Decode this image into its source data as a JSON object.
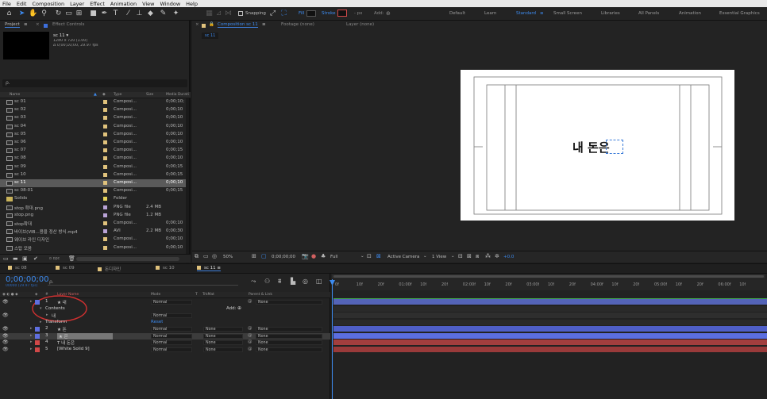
{
  "menu": [
    "File",
    "Edit",
    "Composition",
    "Layer",
    "Effect",
    "Animation",
    "View",
    "Window",
    "Help"
  ],
  "toolbar": {
    "snapping_label": "Snapping",
    "fill_label": "Fill",
    "stroke_label": "Stroke",
    "stroke_px": "- px",
    "add_label": "Add:",
    "workspaces": [
      "Default",
      "Learn",
      "Standard",
      "Small Screen",
      "Libraries",
      "All Panels",
      "Animation",
      "Essential Graphics"
    ],
    "active_workspace": "Standard"
  },
  "project_panel": {
    "tab_project": "Project",
    "tab_effect_controls": "Effect Controls",
    "selected_name": "sc 11 ▾",
    "selected_res": "1280 x 720 (1.00)",
    "selected_dur": "Δ 0;00;10;00, 29.97 fps",
    "search_placeholder": "ρ.",
    "columns": {
      "name": "Name",
      "type": "Type",
      "size": "Size",
      "duration": "Media Durati"
    },
    "items": [
      {
        "name": "sc 01",
        "type": "Composi...",
        "size": "",
        "dur": "0;00;10;",
        "color": "#e0c27c"
      },
      {
        "name": "sc 02",
        "type": "Composi...",
        "size": "",
        "dur": "0;00;10",
        "color": "#e0c27c"
      },
      {
        "name": "sc 03",
        "type": "Composi...",
        "size": "",
        "dur": "0;00;10",
        "color": "#e0c27c"
      },
      {
        "name": "sc 04",
        "type": "Composi...",
        "size": "",
        "dur": "0;00;10",
        "color": "#e0c27c"
      },
      {
        "name": "sc 05",
        "type": "Composi...",
        "size": "",
        "dur": "0;00;10",
        "color": "#e0c27c"
      },
      {
        "name": "sc 06",
        "type": "Composi...",
        "size": "",
        "dur": "0;00;10",
        "color": "#e0c27c"
      },
      {
        "name": "sc 07",
        "type": "Composi...",
        "size": "",
        "dur": "0;00;15",
        "color": "#e0c27c"
      },
      {
        "name": "sc 08",
        "type": "Composi...",
        "size": "",
        "dur": "0;00;10",
        "color": "#e0c27c"
      },
      {
        "name": "sc 09",
        "type": "Composi...",
        "size": "",
        "dur": "0;00;15",
        "color": "#e0c27c"
      },
      {
        "name": "sc 10",
        "type": "Composi...",
        "size": "",
        "dur": "0;00;15",
        "color": "#e0c27c"
      },
      {
        "name": "sc 11",
        "type": "Composi...",
        "size": "",
        "dur": "0;00;10",
        "color": "#e0c27c",
        "selected": true
      },
      {
        "name": "sc 08-01",
        "type": "Composi...",
        "size": "",
        "dur": "0;00;15",
        "color": "#e0c27c"
      },
      {
        "name": "Solids",
        "type": "Folder",
        "size": "",
        "dur": "",
        "color": "#e6d25a"
      },
      {
        "name": "stop 확대.png",
        "type": "PNG file",
        "size": "2.4 MB",
        "dur": "",
        "color": "#b9a3d6"
      },
      {
        "name": "stop.png",
        "type": "PNG file",
        "size": "1.2 MB",
        "dur": "",
        "color": "#b9a3d6"
      },
      {
        "name": "stop확대",
        "type": "Composi...",
        "size": "",
        "dur": "0;00;10",
        "color": "#e0c27c"
      },
      {
        "name": "바이브(VIB...용을 정산 방식.mp4",
        "type": "AVI",
        "size": "2.2 MB",
        "dur": "0;00;30",
        "color": "#b9a3d6"
      },
      {
        "name": "웨이브 라인 디자인",
        "type": "Composi...",
        "size": "",
        "dur": "0;00;10",
        "color": "#e0c27c"
      },
      {
        "name": "스탑 모음",
        "type": "Composi...",
        "size": "",
        "dur": "0;00;10",
        "color": "#e0c27c"
      }
    ],
    "footer_bpc": "8 bpc"
  },
  "comp_panel": {
    "tab_comp": "Composition sc 11",
    "tab_footage": "Footage (none)",
    "tab_layer": "Layer (none)",
    "breadcrumb": "sc 11",
    "canvas_text": "내 돈은",
    "footer": {
      "zoom": "50%",
      "timecode": "0;00;00;00",
      "resolution": "Full",
      "camera": "Active Camera",
      "views": "1 View",
      "exposure": "+0.0"
    }
  },
  "timeline": {
    "tabs": [
      {
        "label": "sc 08",
        "color": "#e0c27c"
      },
      {
        "label": "sc 09",
        "color": "#e0c27c"
      },
      {
        "label": "돈디자인",
        "color": "#e0c27c"
      },
      {
        "label": "sc 10",
        "color": "#e0c27c"
      },
      {
        "label": "sc 11",
        "color": "#e0c27c",
        "active": true
      }
    ],
    "timecode": "0;00;00;00",
    "fps": "00000 (29.97 fps)",
    "search_placeholder": "ρ.",
    "headers": {
      "layer_name": "Layer Name",
      "mode": "Mode",
      "t": "T",
      "trkmat": "TrkMat",
      "parent": "Parent & Link"
    },
    "layers": [
      {
        "num": "1",
        "name": "★ 내",
        "mode": "Normal",
        "trkmat": "",
        "parent": "None",
        "color": "#5f6fe0"
      },
      {
        "num": "2",
        "name": "★ 돈",
        "mode": "Normal",
        "trkmat": "None",
        "parent": "None",
        "color": "#5f6fe0"
      },
      {
        "num": "3",
        "name": "★ 은",
        "mode": "Normal",
        "trkmat": "None",
        "parent": "None",
        "color": "#5f6fe0"
      },
      {
        "num": "4",
        "name": "T 내 돈은",
        "mode": "Normal",
        "trkmat": "None",
        "parent": "None",
        "color": "#d04848"
      },
      {
        "num": "5",
        "name": "[White Solid 9]",
        "mode": "Normal",
        "trkmat": "None",
        "parent": "None",
        "color": "#d04848"
      }
    ],
    "sub": {
      "contents": "Contents",
      "add": "Add:",
      "shape": "내",
      "shape_mode": "Normal",
      "transform": "Transform",
      "reset": "Reset"
    },
    "ruler": [
      "0f",
      "10f",
      "20f",
      "01:00f",
      "10f",
      "20f",
      "02:00f",
      "10f",
      "20f",
      "03:00f",
      "10f",
      "20f",
      "04:00f",
      "10f",
      "20f",
      "05:00f",
      "10f",
      "20f",
      "06:00f",
      "10f"
    ]
  }
}
